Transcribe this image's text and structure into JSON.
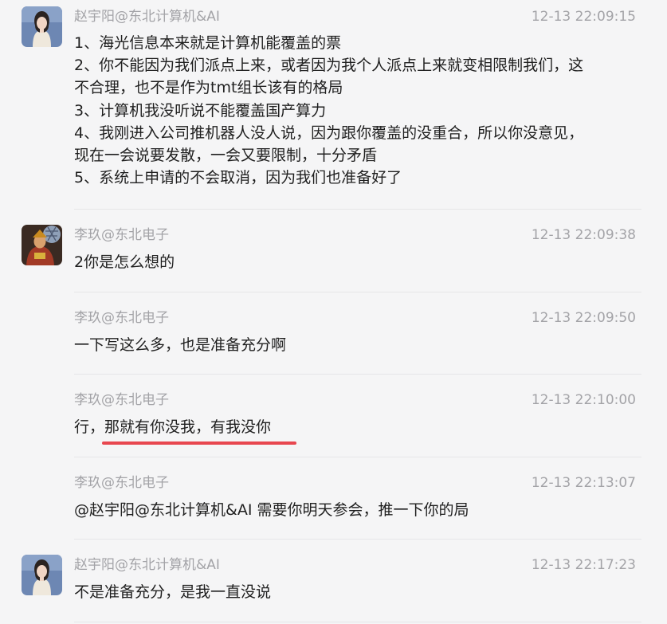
{
  "messages": [
    {
      "sender": "赵宇阳@东北计算机&AI",
      "time": "12-13 22:09:15",
      "lines": [
        "1、海光信息本来就是计算机能覆盖的票",
        "2、你不能因为我们派点上来，或者因为我个人派点上来就变相限制我们，这",
        "不合理，也不是作为tmt组长该有的格局",
        "3、计算机我没听说不能覆盖国产算力",
        "4、我刚进入公司推机器人没人说，因为跟你覆盖的没重合，所以你没意见，",
        "现在一会说要发散，一会又要限制，十分矛盾",
        "5、系统上申请的不会取消，因为我们也准备好了"
      ]
    },
    {
      "sender": "李玖@东北电子",
      "time": "12-13 22:09:38",
      "lines": [
        "2你是怎么想的"
      ]
    },
    {
      "sender": "李玖@东北电子",
      "time": "12-13 22:09:50",
      "lines": [
        "一下写这么多，也是准备充分啊"
      ]
    },
    {
      "sender": "李玖@东北电子",
      "time": "12-13 22:10:00",
      "lines": [
        "行，那就有你没我，有我没你"
      ]
    },
    {
      "sender": "李玖@东北电子",
      "time": "12-13 22:13:07",
      "lines": [
        "@赵宇阳@东北计算机&AI 需要你明天参会，推一下你的局"
      ]
    },
    {
      "sender": "赵宇阳@东北计算机&AI",
      "time": "12-13 22:17:23",
      "lines": [
        "不是准备充分，是我一直没说"
      ]
    }
  ],
  "colors": {
    "background": "#f5f5f6",
    "meta_text": "#a3a3a7",
    "body_text": "#1f1f1f",
    "divider": "#e6e6e8",
    "highlight_underline": "#e8474f"
  }
}
